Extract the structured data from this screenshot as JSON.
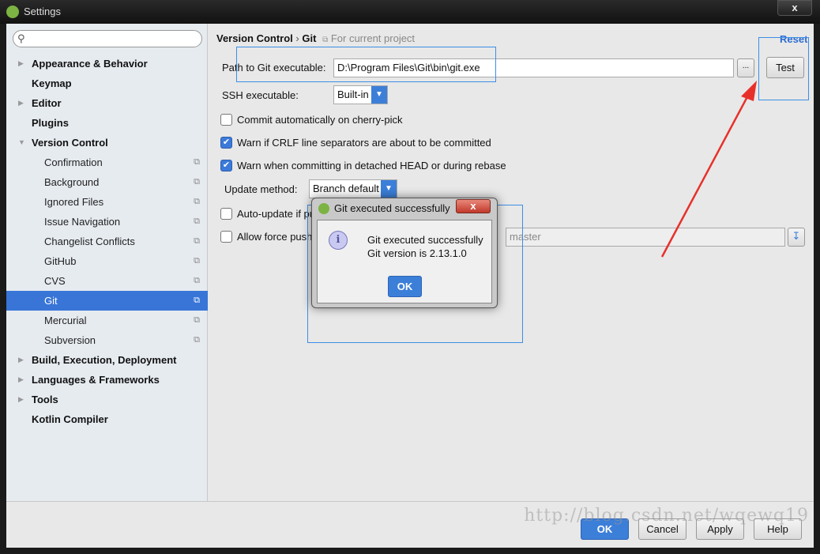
{
  "window": {
    "title": "Settings",
    "close": "x"
  },
  "sidebar": {
    "search_placeholder": "",
    "items": [
      {
        "label": "Appearance & Behavior",
        "level": "top",
        "expandable": true
      },
      {
        "label": "Keymap",
        "level": "top"
      },
      {
        "label": "Editor",
        "level": "top",
        "expandable": true
      },
      {
        "label": "Plugins",
        "level": "top"
      },
      {
        "label": "Version Control",
        "level": "top",
        "expanded": true
      },
      {
        "label": "Confirmation",
        "level": "sub"
      },
      {
        "label": "Background",
        "level": "sub"
      },
      {
        "label": "Ignored Files",
        "level": "sub"
      },
      {
        "label": "Issue Navigation",
        "level": "sub"
      },
      {
        "label": "Changelist Conflicts",
        "level": "sub"
      },
      {
        "label": "GitHub",
        "level": "sub"
      },
      {
        "label": "CVS",
        "level": "sub"
      },
      {
        "label": "Git",
        "level": "sub",
        "selected": true
      },
      {
        "label": "Mercurial",
        "level": "sub"
      },
      {
        "label": "Subversion",
        "level": "sub"
      },
      {
        "label": "Build, Execution, Deployment",
        "level": "top",
        "expandable": true
      },
      {
        "label": "Languages & Frameworks",
        "level": "top",
        "expandable": true
      },
      {
        "label": "Tools",
        "level": "top",
        "expandable": true
      },
      {
        "label": "Kotlin Compiler",
        "level": "top"
      }
    ]
  },
  "main": {
    "breadcrumb": {
      "parent": "Version Control",
      "sep": "›",
      "current": "Git",
      "scope": "For current project"
    },
    "reset": "Reset",
    "path_label": "Path to Git executable:",
    "path_value": "D:\\Program Files\\Git\\bin\\git.exe",
    "browse": "...",
    "test": "Test",
    "ssh_label": "SSH executable:",
    "ssh_value": "Built-in",
    "checks": [
      {
        "label": "Commit automatically on cherry-pick",
        "checked": false
      },
      {
        "label": "Warn if CRLF line separators are about to be committed",
        "checked": true
      },
      {
        "label": "Warn when committing in detached HEAD or during rebase",
        "checked": true
      }
    ],
    "update_label": "Update method:",
    "update_value": "Branch default",
    "auto_update": {
      "label": "Auto-update if push of the current branch was rejected",
      "checked": false
    },
    "force_push": {
      "label": "Allow force push",
      "checked": false,
      "branch_value": "master"
    }
  },
  "dialog": {
    "title": "Git executed successfully",
    "close": "x",
    "line1": "Git executed successfully",
    "line2": "Git version is 2.13.1.0",
    "ok": "OK"
  },
  "footer": {
    "ok": "OK",
    "cancel": "Cancel",
    "apply": "Apply",
    "help": "Help"
  },
  "watermark": "http://blog.csdn.net/wqewq19",
  "colors": {
    "accent": "#3c7fd9",
    "selection": "#3875d7",
    "annotation_arrow": "#e8302a"
  }
}
